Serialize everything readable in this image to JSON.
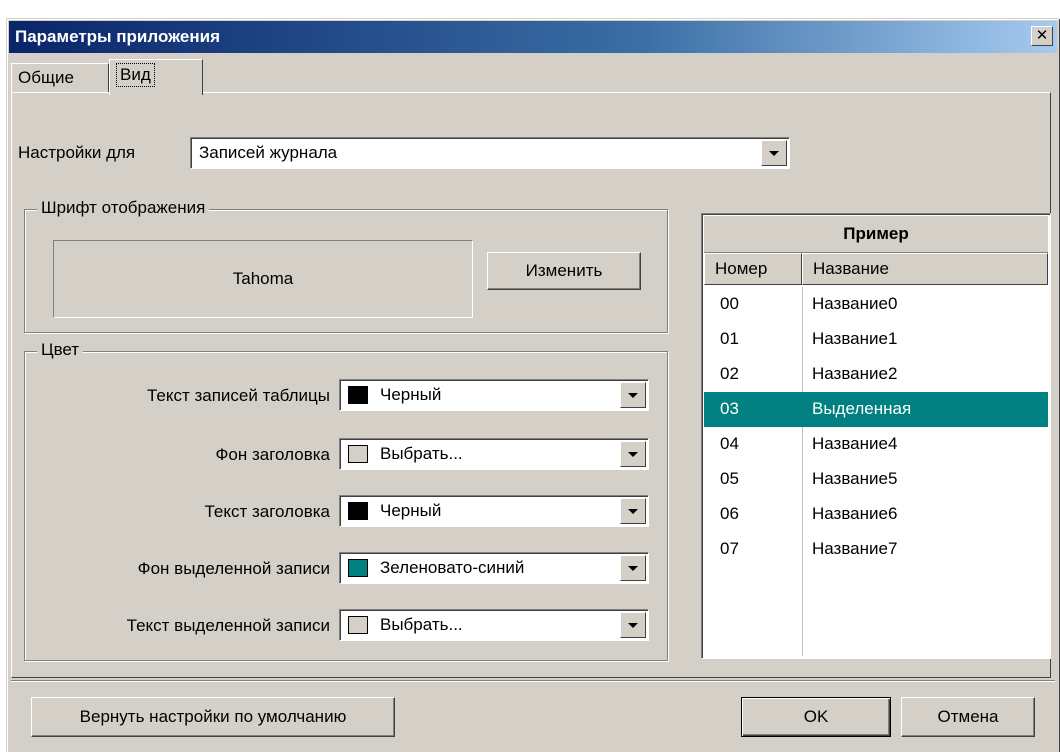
{
  "window": {
    "title": "Параметры приложения",
    "close_glyph": "✕",
    "close_icon": "close-icon"
  },
  "tabs": [
    {
      "label": "Общие",
      "active": false
    },
    {
      "label": "Вид",
      "active": true
    }
  ],
  "settings_for": {
    "label": "Настройки для",
    "value": "Записей журнала"
  },
  "font_group": {
    "legend": "Шрифт отображения",
    "font_name": "Tahoma",
    "change_button": "Изменить"
  },
  "color_group": {
    "legend": "Цвет",
    "rows": [
      {
        "label": "Текст записей таблицы",
        "value": "Черный",
        "swatch": "#000000"
      },
      {
        "label": "Фон заголовка",
        "value": "Выбрать...",
        "swatch": "#d4d0c8"
      },
      {
        "label": "Текст заголовка",
        "value": "Черный",
        "swatch": "#000000"
      },
      {
        "label": "Фон выделенной записи",
        "value": "Зеленовато-синий",
        "swatch": "#008080"
      },
      {
        "label": "Текст выделенной записи",
        "value": "Выбрать...",
        "swatch": "#d4d0c8"
      }
    ]
  },
  "sample": {
    "title": "Пример",
    "columns": [
      "Номер",
      "Название"
    ],
    "rows": [
      {
        "num": "00",
        "name": "Название0",
        "selected": false
      },
      {
        "num": "01",
        "name": "Название1",
        "selected": false
      },
      {
        "num": "02",
        "name": "Название2",
        "selected": false
      },
      {
        "num": "03",
        "name": "Выделенная",
        "selected": true
      },
      {
        "num": "04",
        "name": "Название4",
        "selected": false
      },
      {
        "num": "05",
        "name": "Название5",
        "selected": false
      },
      {
        "num": "06",
        "name": "Название6",
        "selected": false
      },
      {
        "num": "07",
        "name": "Название7",
        "selected": false
      }
    ],
    "selected_bg": "#008080",
    "selected_fg": "#ffffff"
  },
  "footer": {
    "reset_button": "Вернуть настройки по умолчанию",
    "ok_button": "OK",
    "cancel_button": "Отмена"
  }
}
